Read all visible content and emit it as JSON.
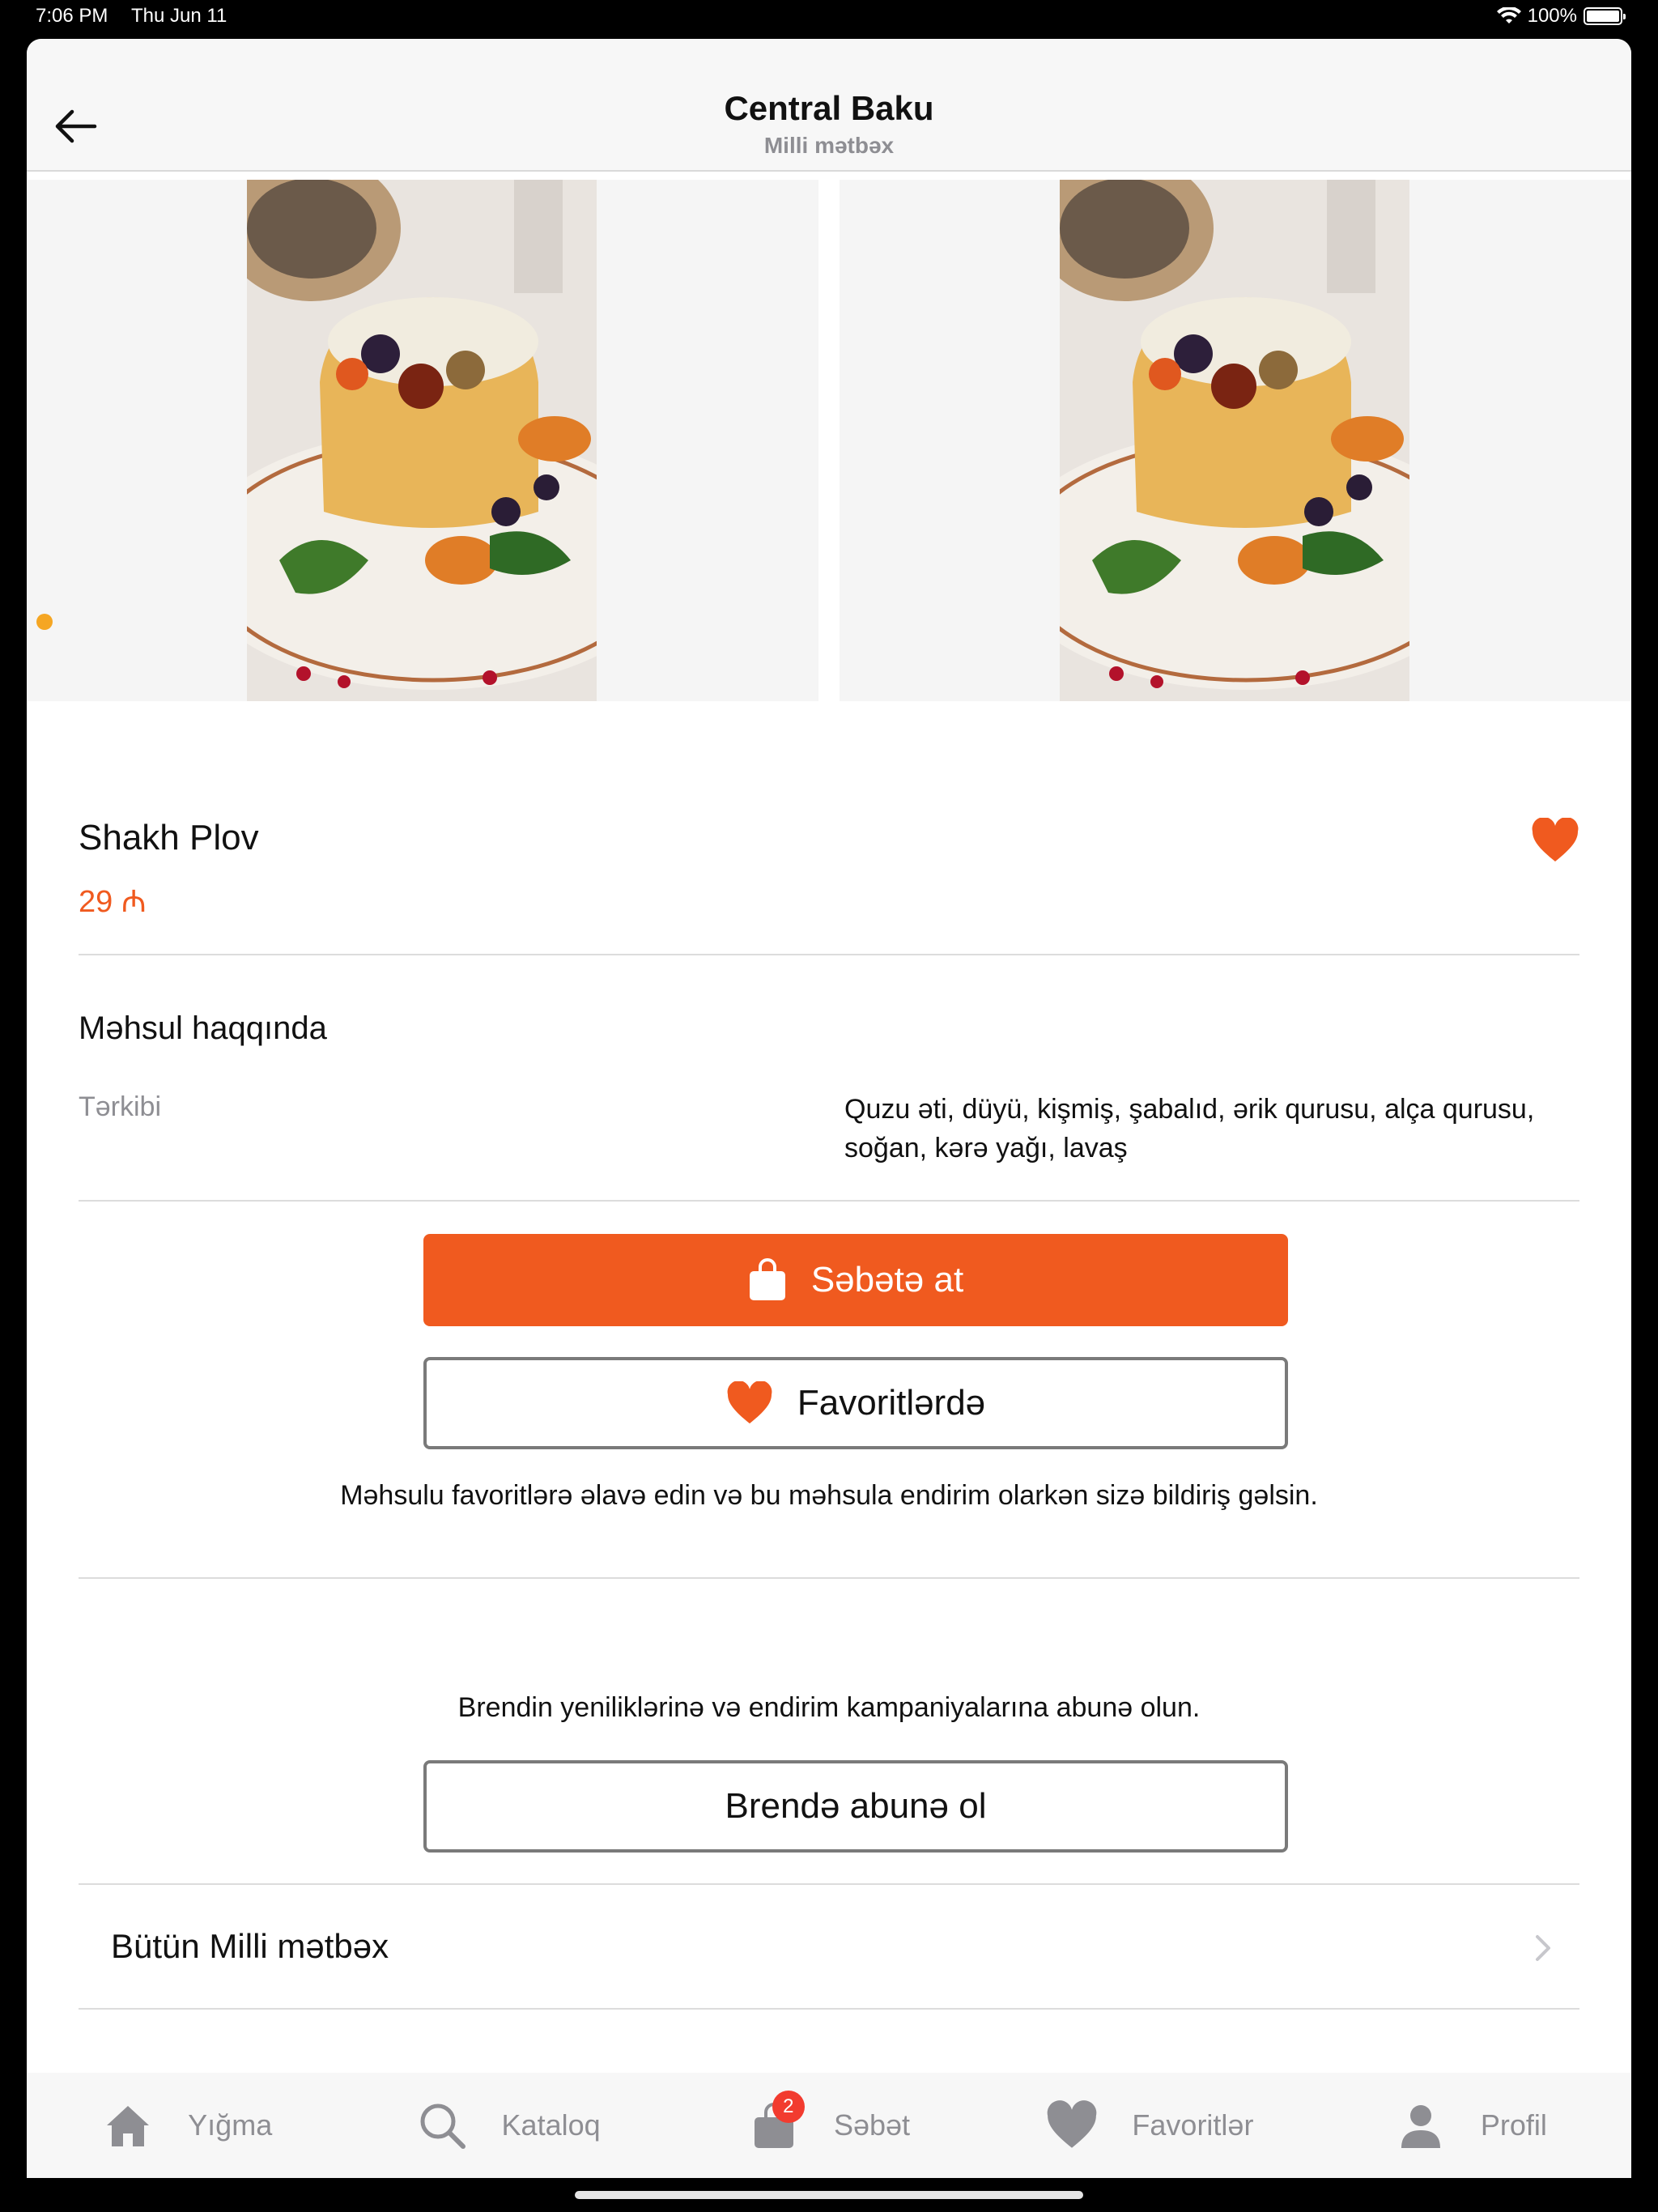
{
  "status_bar": {
    "time": "7:06 PM",
    "date": "Thu Jun 11",
    "battery": "100%"
  },
  "header": {
    "title": "Central Baku",
    "subtitle": "Milli mətbəx"
  },
  "product": {
    "name": "Shakh Plov",
    "price": "29 ₼",
    "is_favorite": true,
    "gallery": {
      "images": [
        "shakh-plov-photo",
        "shakh-plov-photo"
      ],
      "active_index": 0
    }
  },
  "about": {
    "title": "Məhsul haqqında",
    "composition_label": "Tərkibi",
    "composition_value": "Quzu əti, düyü, kişmiş, şabalıd, ərik qurusu, alça qurusu, soğan, kərə yağı, lavaş"
  },
  "actions": {
    "add_to_cart": "Səbətə at",
    "favorites": "Favoritlərdə",
    "favorites_hint": "Məhsulu favoritlərə əlavə edin və bu məhsula endirim olarkən sizə bildiriş gəlsin.",
    "subscribe_hint": "Brendin yeniliklərinə və endirim kampaniyalarına abunə olun.",
    "subscribe_button": "Brendə abunə ol"
  },
  "all_category": {
    "label": "Bütün Milli mətbəx"
  },
  "tabbar": {
    "items": [
      {
        "label": "Yığma",
        "icon": "home-icon"
      },
      {
        "label": "Kataloq",
        "icon": "search-icon"
      },
      {
        "label": "Səbət",
        "icon": "bag-icon",
        "badge": "2"
      },
      {
        "label": "Favoritlər",
        "icon": "heart-icon"
      },
      {
        "label": "Profil",
        "icon": "person-icon"
      }
    ]
  },
  "colors": {
    "accent": "#f05a1f",
    "badge": "#f23b2f",
    "dot": "#f5a623",
    "inactive": "#8e8e93"
  }
}
